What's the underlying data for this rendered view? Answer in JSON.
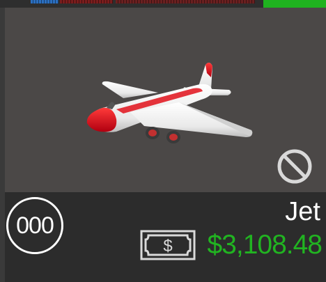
{
  "vehicle": {
    "name": "Jet",
    "level": "000",
    "price": "$3,108.48",
    "currency_symbol": "$"
  },
  "icons": {
    "locked": "prohibited-icon",
    "money": "banknote-icon"
  },
  "colors": {
    "price": "#21b421",
    "card_bg": "#4b4847",
    "panel_bg": "#2c2c2c",
    "plane_accent": "#e0101a"
  }
}
